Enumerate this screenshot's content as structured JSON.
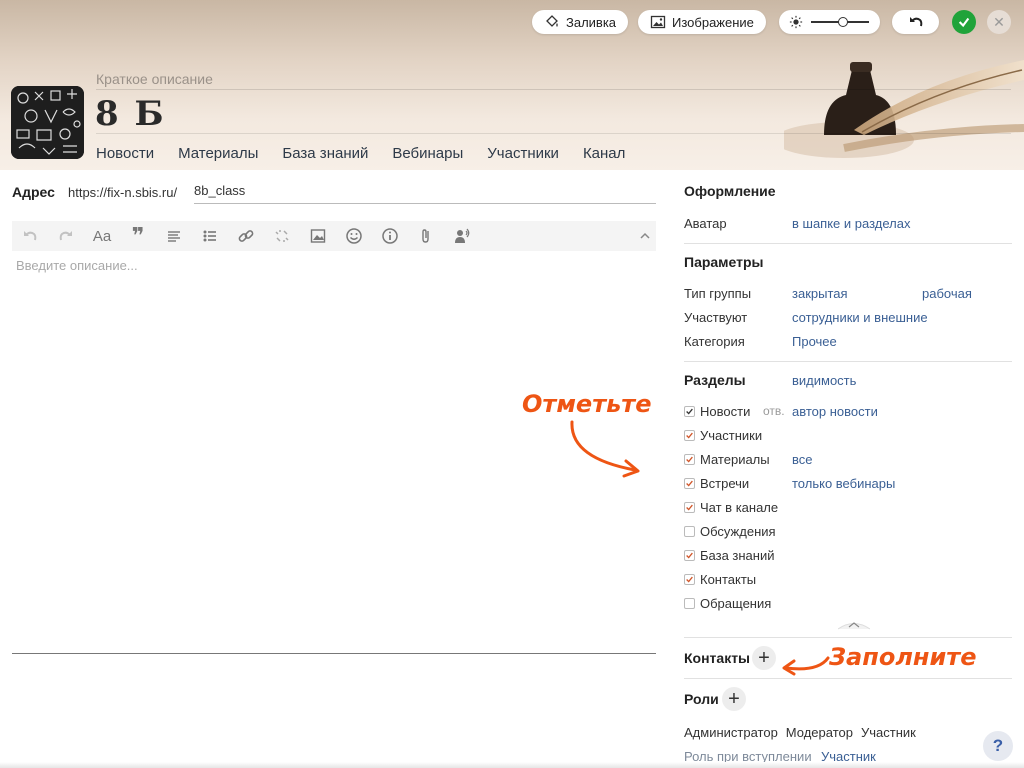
{
  "header": {
    "fill_label": "Заливка",
    "image_label": "Изображение",
    "brightness_level": 0.55,
    "short_description_placeholder": "Краткое описание",
    "group_title": "8 Б",
    "tabs": [
      {
        "label": "Новости"
      },
      {
        "label": "Материалы"
      },
      {
        "label": "База знаний"
      },
      {
        "label": "Вебинары"
      },
      {
        "label": "Участники"
      },
      {
        "label": "Канал"
      }
    ]
  },
  "address": {
    "label": "Адрес",
    "prefix": "https://fix-n.sbis.ru/",
    "value": "8b_class"
  },
  "editor": {
    "placeholder": "Введите описание...",
    "toolbar_font_label": "Aa",
    "toolbar_quote_label": "❞"
  },
  "design": {
    "heading": "Оформление",
    "avatar_label": "Аватар",
    "avatar_value": "в шапке и разделах"
  },
  "params": {
    "heading": "Параметры",
    "group_type_label": "Тип группы",
    "group_type_value": "закрытая",
    "group_type_value2": "рабочая",
    "participants_label": "Участвуют",
    "participants_value": "сотрудники и внешние",
    "category_label": "Категория",
    "category_value": "Прочее"
  },
  "sections": {
    "heading": "Разделы",
    "visibility_link": "видимость",
    "items": [
      {
        "label": "Новости",
        "checked": true,
        "extra_label": "отв.",
        "value": "автор новости"
      },
      {
        "label": "Участники",
        "checked": true
      },
      {
        "label": "Материалы",
        "checked": true,
        "value": "все"
      },
      {
        "label": "Встречи",
        "checked": true,
        "value": "только вебинары"
      },
      {
        "label": "Чат в канале",
        "checked": true
      },
      {
        "label": "Обсуждения",
        "checked": false
      },
      {
        "label": "База знаний",
        "checked": true
      },
      {
        "label": "Контакты",
        "checked": true
      },
      {
        "label": "Обращения",
        "checked": false
      }
    ]
  },
  "contacts": {
    "heading": "Контакты"
  },
  "roles": {
    "heading": "Роли",
    "items": [
      "Администратор",
      "Модератор",
      "Участник"
    ],
    "join_role_label": "Роль при вступлении",
    "join_role_value": "Участник"
  },
  "callouts": {
    "mark": "Отметьте",
    "fill": "Заполните"
  },
  "help_label": "?",
  "colors": {
    "link": "#3a5f94",
    "callout": "#ee5514",
    "ok": "#20a33a",
    "checkmark": "#d0562a"
  }
}
